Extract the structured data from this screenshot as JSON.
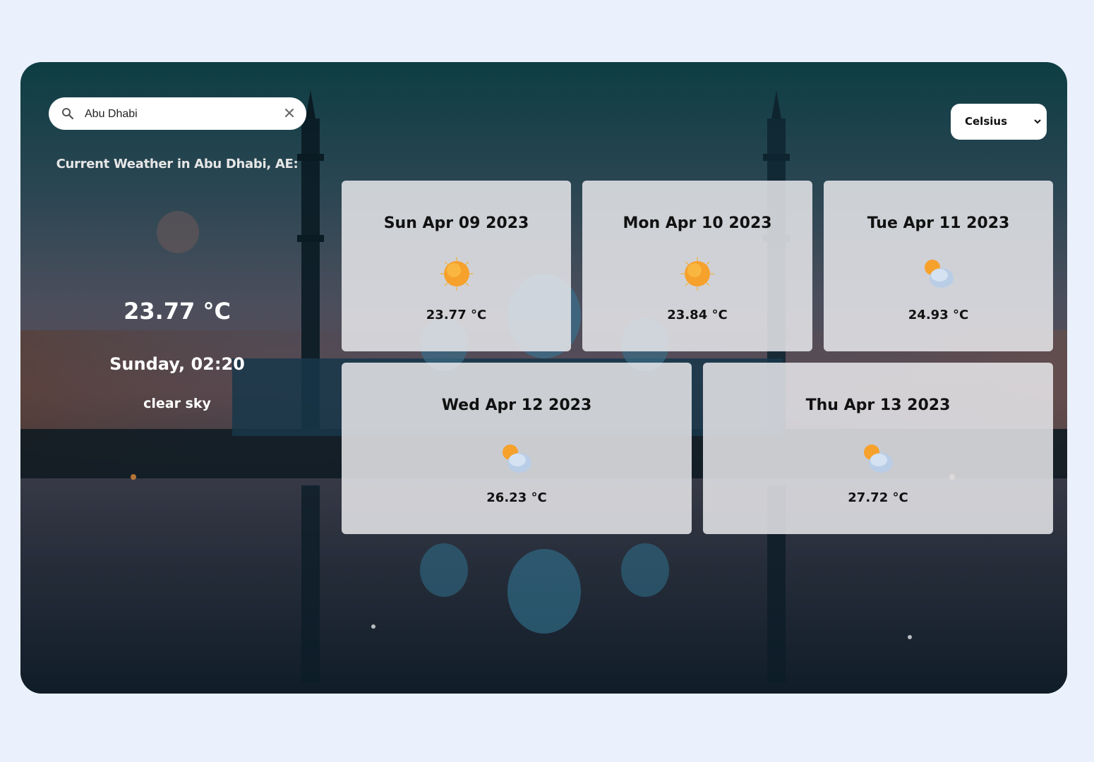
{
  "search": {
    "value": "Abu Dhabi",
    "icon": "search-icon",
    "clear_icon": "close-icon"
  },
  "unit_select": {
    "selected": "Celsius",
    "icon": "chevron-down-icon"
  },
  "current": {
    "heading": "Current Weather in Abu Dhabi, AE:",
    "temperature": "23.77 °C",
    "day_time": "Sunday, 02:20",
    "description": "clear sky",
    "icon": "clear-sky-icon"
  },
  "forecast": [
    {
      "date": "Sun Apr 09 2023",
      "temp": "23.77 °C",
      "icon": "sun-icon"
    },
    {
      "date": "Mon Apr 10 2023",
      "temp": "23.84 °C",
      "icon": "sun-icon"
    },
    {
      "date": "Tue Apr 11 2023",
      "temp": "24.93 °C",
      "icon": "partly-cloudy-icon"
    },
    {
      "date": "Wed Apr 12 2023",
      "temp": "26.23 °C",
      "icon": "partly-cloudy-icon"
    },
    {
      "date": "Thu Apr 13 2023",
      "temp": "27.72 °C",
      "icon": "partly-cloudy-icon"
    }
  ],
  "colors": {
    "page_background": "#eaf1fd",
    "card_background": "#e8e8eb",
    "text_dark": "#111111",
    "text_light": "#ffffff"
  }
}
